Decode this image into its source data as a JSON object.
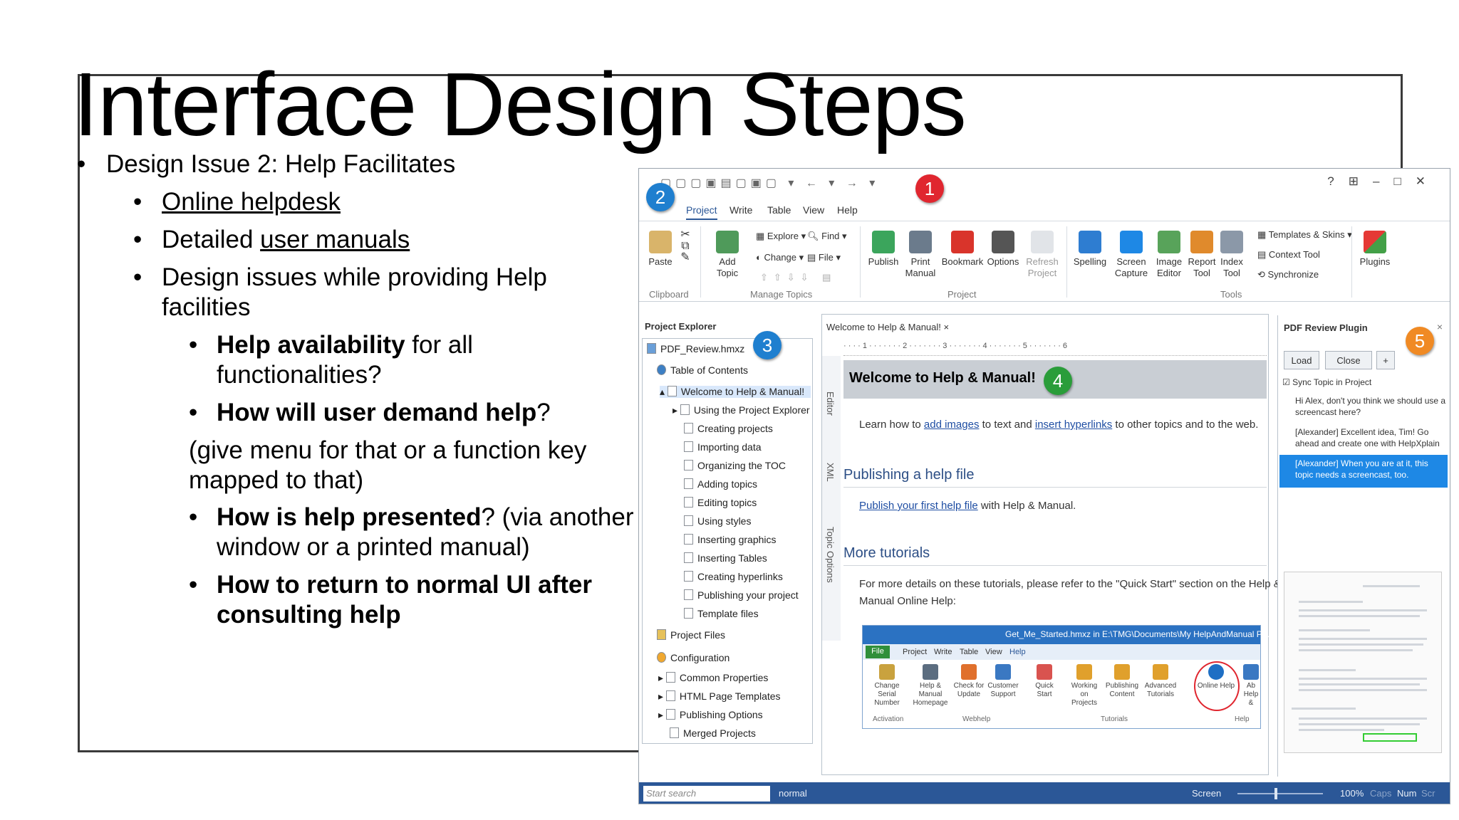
{
  "slide": {
    "title": "Interface Design Steps",
    "bullets": {
      "issue": "Design Issue 2: Help Facilitates",
      "online": "Online helpdesk",
      "manuals_pre": "Detailed ",
      "manuals_link": "user manuals",
      "design_line1": "Design issues while providing Help",
      "design_line2": "facilities",
      "avail_bold": "Help availability",
      "avail_rest": " for all",
      "avail_line2": "functionalities?",
      "demand_bold": "How will user demand help",
      "demand_rest": "?",
      "give_line1": "(give menu for that or a function key",
      "give_line2": "mapped to that)",
      "present_bold": "How is help presented",
      "present_rest": "? (via another",
      "present_line2": "window or a printed manual)",
      "return_line1": "How to return to normal UI after",
      "return_line2": "consulting help"
    }
  },
  "app": {
    "tabs": [
      "Project",
      "Write",
      "Table",
      "View",
      "Help"
    ],
    "window_controls": [
      "?",
      "⊞",
      "–",
      "□",
      "✕"
    ],
    "ribbon": {
      "paste": "Paste",
      "add_topic": "Add Topic",
      "explore": "Explore",
      "find": "Find",
      "change": "Change",
      "file": "File",
      "publish": "Publish",
      "print_manual": [
        "Print",
        "Manual"
      ],
      "bookmark": "Bookmark",
      "options": "Options",
      "refresh": [
        "Refresh",
        "Project"
      ],
      "spelling": "Spelling",
      "screen_capture": [
        "Screen",
        "Capture"
      ],
      "image_editor": [
        "Image",
        "Editor"
      ],
      "report_tool": [
        "Report",
        "Tool"
      ],
      "index_tool": [
        "Index",
        "Tool"
      ],
      "templates": "Templates & Skins",
      "context_tool": "Context Tool",
      "synchronize": "Synchronize",
      "plugins": "Plugins",
      "groups": [
        "Clipboard",
        "Manage Topics",
        "Project",
        "Tools"
      ]
    },
    "explorer": {
      "title": "Project Explorer",
      "project": "PDF_Review.hmxz",
      "toc": "Table of Contents",
      "items": [
        "Welcome to Help & Manual!",
        "Using the Project Explorer",
        "Creating projects",
        "Importing data",
        "Organizing the TOC",
        "Adding topics",
        "Editing topics",
        "Using styles",
        "Inserting graphics",
        "Inserting Tables",
        "Creating hyperlinks",
        "Publishing your project",
        "Template files"
      ],
      "project_files": "Project Files",
      "configuration": "Configuration",
      "config_items": [
        "Common Properties",
        "HTML Page Templates",
        "Publishing Options",
        "Merged Projects"
      ]
    },
    "editor": {
      "tab": "Welcome to Help & Manual!",
      "side_tabs": [
        "Editor",
        "XML",
        "Topic Options"
      ],
      "ruler": "· · · · 1 · · · · · · · 2 · · · · · · · 3 · · · · · · · 4 · · · · · · · 5 · · · · · · · 6",
      "heading": "Welcome to Help & Manual!",
      "learn_pre": "Learn how to ",
      "learn_link1": "add images",
      "learn_mid": " to text and ",
      "learn_link2": "insert hyperlinks",
      "learn_post": " to other topics and to the web.",
      "pub_head": "Publishing a help file",
      "pub_link": "Publish your first help file",
      "pub_post": " with Help & Manual.",
      "more_head": "More tutorials",
      "more_line1": "For more details on these tutorials, please refer to the \"Quick Start\" section on the Help &",
      "more_line2": "Manual Online Help:"
    },
    "embedded": {
      "title": "Get_Me_Started.hmxz in E:\\TMG\\Documents\\My HelpAndManual Pr...",
      "tabs": [
        "File",
        "Project",
        "Write",
        "Table",
        "View",
        "Help"
      ],
      "buttons": [
        [
          "Change Serial",
          "Number"
        ],
        [
          "Help & Manual",
          "Homepage"
        ],
        [
          "Check for",
          "Update"
        ],
        [
          "Customer",
          "Support"
        ],
        [
          "Quick Start",
          ""
        ],
        [
          "Working on",
          "Projects"
        ],
        [
          "Publishing",
          "Content"
        ],
        [
          "Advanced",
          "Tutorials"
        ],
        [
          "Online Help",
          ""
        ],
        [
          "Ab",
          "Help &"
        ]
      ],
      "groups": [
        "Activation",
        "Webhelp",
        "Tutorials",
        "Help"
      ]
    },
    "review": {
      "title": "PDF Review Plugin",
      "load": "Load",
      "close": "Close",
      "plus": "+",
      "sync": "Sync Topic in Project",
      "comment1": "Hi Alex, don't you think we should use a screencast here?",
      "comment2": "[Alexander] Excellent idea, Tim! Go ahead and create one with HelpXplain",
      "comment3": "[Alexander] When you are at it, this topic needs a screencast, too."
    },
    "status": {
      "search_placeholder": "Start search",
      "style": "normal",
      "screen": "Screen",
      "zoom": "100%",
      "caps": "Caps",
      "num": "Num",
      "scr": "Scr"
    },
    "badges": [
      "1",
      "2",
      "3",
      "4",
      "5"
    ]
  },
  "colors": {
    "badge_red": "#e0262f",
    "badge_blue": "#1f7fcf",
    "badge_green": "#2a9d3a",
    "badge_orange": "#f08a24",
    "status_bar": "#2b5797"
  }
}
